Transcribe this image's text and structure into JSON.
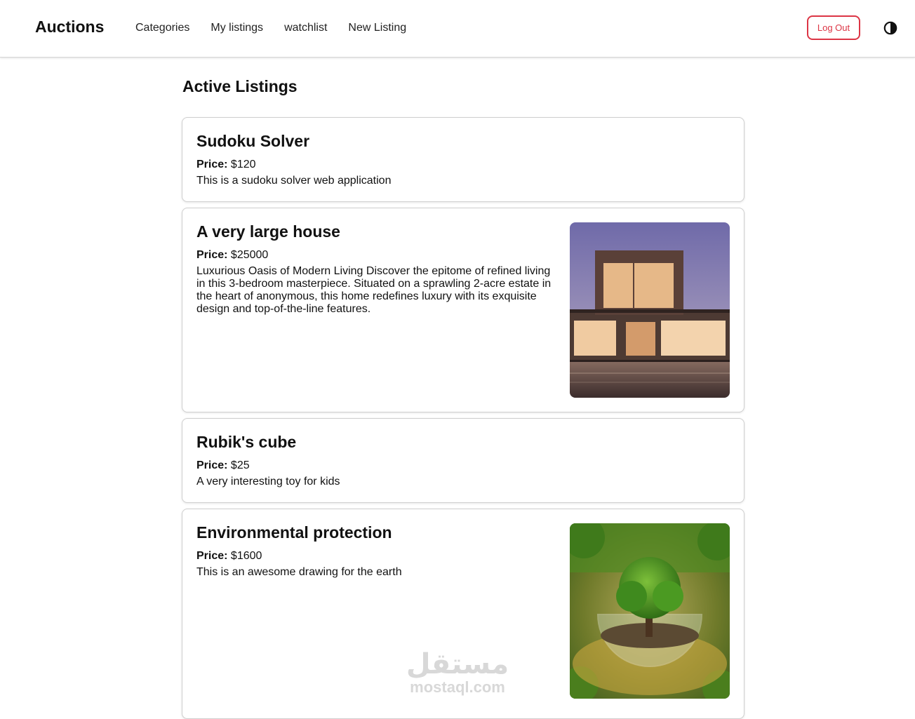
{
  "nav": {
    "brand": "Auctions",
    "links": [
      "Categories",
      "My listings",
      "watchlist",
      "New Listing"
    ],
    "logout": "Log Out",
    "theme_icon": "contrast-icon"
  },
  "page": {
    "title": "Active Listings"
  },
  "price_label": "Price:",
  "listings": [
    {
      "title": "Sudoku Solver",
      "price": "$120",
      "description": "This is a sudoku solver web application"
    },
    {
      "title": "A very large house",
      "price": "$25000",
      "description": "Luxurious Oasis of Modern Living Discover the epitome of refined living in this 3-bedroom masterpiece. Situated on a sprawling 2-acre estate in the heart of anonymous, this home redefines luxury with its exquisite design and top-of-the-line features.",
      "image": "modern-house-photo"
    },
    {
      "title": "Rubik's cube",
      "price": "$25",
      "description": "A very interesting toy for kids"
    },
    {
      "title": "Environmental protection",
      "price": "$1600",
      "description": "This is an awesome drawing for the earth",
      "image": "tree-in-glass-sphere-photo"
    }
  ],
  "watermark": {
    "arabic": "مستقل",
    "latin": "mostaql.com"
  },
  "colors": {
    "accent_red": "#dc3545",
    "border": "#cfcfcf"
  }
}
